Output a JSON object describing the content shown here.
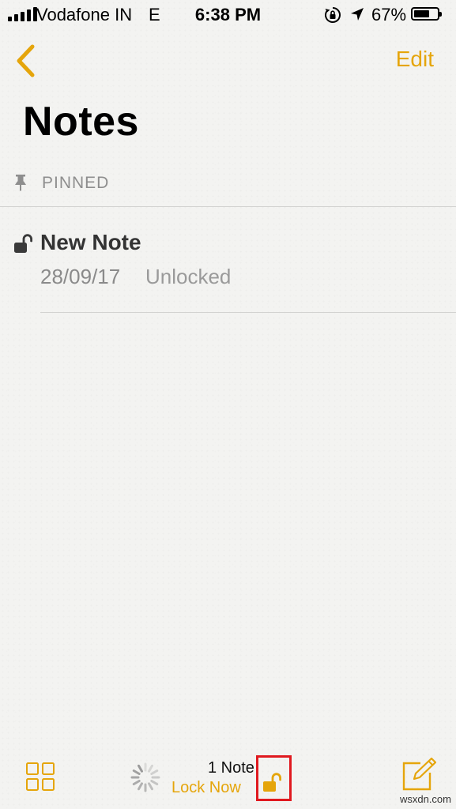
{
  "status_bar": {
    "carrier": "Vodafone IN",
    "network": "E",
    "time": "6:38 PM",
    "battery_percent": "67%",
    "battery_level": 0.67,
    "icons": [
      "signal-bars-icon",
      "orientation-lock-icon",
      "location-arrow-icon",
      "battery-icon"
    ]
  },
  "nav": {
    "back_icon": "chevron-left-icon",
    "edit_label": "Edit"
  },
  "page": {
    "title": "Notes"
  },
  "pinned": {
    "label": "PINNED",
    "icon": "pin-icon"
  },
  "notes": [
    {
      "title": "New Note",
      "date": "28/09/17",
      "status": "Unlocked",
      "icon": "lock-open-icon"
    }
  ],
  "toolbar": {
    "count": "1 Note",
    "lock_now_label": "Lock Now",
    "icons": [
      "gallery-grid-icon",
      "loading-spinner-icon",
      "padlock-open-icon",
      "compose-icon"
    ]
  },
  "watermark": "wsxdn.com",
  "colors": {
    "accent": "#e5a50b",
    "highlight": "#e0191f",
    "secondary_text": "#8e8e8e"
  }
}
